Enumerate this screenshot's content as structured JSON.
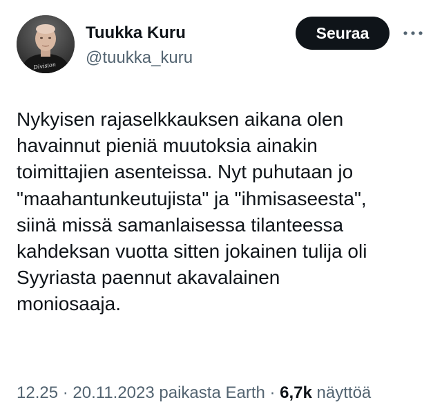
{
  "author": {
    "display_name": "Tuukka Kuru",
    "handle": "@tuukka_kuru",
    "avatar_shirt_text": "Division"
  },
  "actions": {
    "follow_label": "Seuraa",
    "more_icon": "more-horizontal-icon"
  },
  "tweet": {
    "lines": [
      "Nykyisen rajaselkkauksen aikana olen",
      "havainnut pieniä muutoksia ainakin",
      "toimittajien asenteissa. Nyt puhutaan jo",
      "\"maahantunkeutujista\" ja \"ihmisaseesta\",",
      "siinä missä samanlaisessa tilanteessa",
      "kahdeksan vuotta sitten jokainen tulija oli",
      "Syyriasta paennut akavalainen",
      "moniosaaja."
    ]
  },
  "meta": {
    "time": "12.25",
    "separator": " · ",
    "date": "20.11.2023",
    "source": "paikasta Earth",
    "views_count": "6,7k",
    "views_label": " näyttöä"
  },
  "colors": {
    "text_primary": "#0f1419",
    "text_secondary": "#536471",
    "button_bg": "#0f1419",
    "button_text": "#ffffff",
    "background": "#ffffff"
  }
}
